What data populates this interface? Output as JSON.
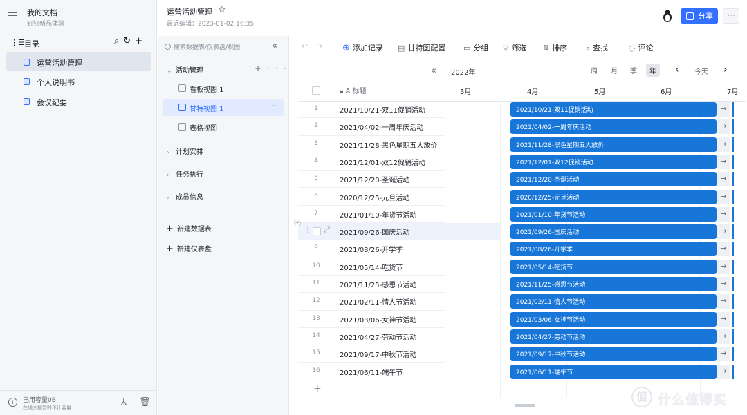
{
  "sidebar": {
    "doc_title": "我的文档",
    "doc_subtitle": "钉钉新品体验",
    "toc_label": "目录",
    "items": [
      {
        "label": "运营活动管理",
        "active": true
      },
      {
        "label": "个人说明书",
        "active": false
      },
      {
        "label": "会议纪要",
        "active": false
      }
    ],
    "storage_used": "已用容量0B",
    "storage_note": "在线文档暂时不计容量"
  },
  "header": {
    "title": "运营活动管理",
    "last_edited": "最近编辑：2023-01-02 16:35",
    "share_label": "分享",
    "more_label": "···"
  },
  "views_panel": {
    "search_placeholder": "搜索数据表/仪表盘/视图",
    "groups": [
      {
        "label": "活动管理",
        "expanded": true
      },
      {
        "label": "计划安排",
        "expanded": false
      },
      {
        "label": "任务执行",
        "expanded": false
      },
      {
        "label": "成员信息",
        "expanded": false
      }
    ],
    "views": [
      {
        "label": "看板视图 1",
        "active": false
      },
      {
        "label": "甘特视图 1",
        "active": true
      },
      {
        "label": "表格视图",
        "active": false
      }
    ],
    "new_table": "新建数据表",
    "new_dashboard": "新建仪表盘"
  },
  "toolbar": {
    "add_record": "添加记录",
    "gantt_config": "甘特图配置",
    "group": "分组",
    "filter": "筛选",
    "sort": "排序",
    "find": "查找",
    "comment": "评论"
  },
  "gantt": {
    "year": "2022年",
    "scales": [
      "周",
      "月",
      "季",
      "年"
    ],
    "active_scale": "年",
    "today_label": "今天",
    "title_header": "标题",
    "months": [
      "3月",
      "4月",
      "5月",
      "6月",
      "7月"
    ],
    "highlight_row": 8,
    "rows": [
      {
        "n": "1",
        "title": "2021/10/21-双11促销活动"
      },
      {
        "n": "2",
        "title": "2021/04/02-一周年庆活动"
      },
      {
        "n": "3",
        "title": "2021/11/28-黑色星期五大放价"
      },
      {
        "n": "4",
        "title": "2021/12/01-双12促销活动"
      },
      {
        "n": "5",
        "title": "2021/12/20-圣诞活动"
      },
      {
        "n": "6",
        "title": "2020/12/25-元旦活动"
      },
      {
        "n": "7",
        "title": "2021/01/10-年货节活动"
      },
      {
        "n": "",
        "title": "2021/09/26-国庆活动"
      },
      {
        "n": "9",
        "title": "2021/08/26-开学季"
      },
      {
        "n": "10",
        "title": "2021/05/14-吃货节"
      },
      {
        "n": "11",
        "title": "2021/11/25-感恩节活动"
      },
      {
        "n": "12",
        "title": "2021/02/11-情人节活动"
      },
      {
        "n": "13",
        "title": "2021/03/06-女神节活动"
      },
      {
        "n": "14",
        "title": "2021/04/27-劳动节活动"
      },
      {
        "n": "15",
        "title": "2021/09/17-中秋节活动"
      },
      {
        "n": "16",
        "title": "2021/06/11-端午节"
      }
    ]
  },
  "watermark": {
    "text": "什么值得买",
    "logo": "值"
  },
  "colors": {
    "accent": "#3370ff",
    "bar": "#1776d8"
  }
}
